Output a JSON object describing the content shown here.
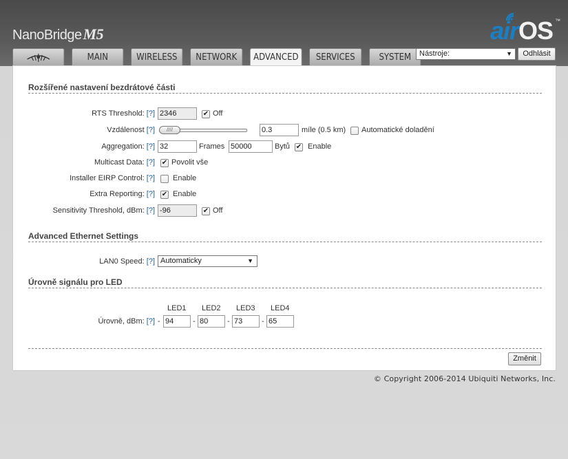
{
  "header": {
    "brand": "NanoBridge",
    "model": "M5",
    "logo_air": "air",
    "logo_os": "OS",
    "logo_tm": "™"
  },
  "tabs": [
    {
      "label": "MAIN"
    },
    {
      "label": "WIRELESS"
    },
    {
      "label": "NETWORK"
    },
    {
      "label": "ADVANCED"
    },
    {
      "label": "SERVICES"
    },
    {
      "label": "SYSTEM"
    }
  ],
  "toolbar": {
    "tools_selected": "Nástroje:",
    "logout_label": "Odhlásit"
  },
  "help": "[?]",
  "wireless": {
    "title": "Rozšířené nastavení bezdrátové části",
    "rts_label": "RTS Threshold:",
    "rts_value": "2346",
    "rts_off": "Off",
    "distance_label": "Vzdálenost",
    "distance_value": "0.3",
    "distance_unit": "míle (0.5 km)",
    "distance_auto": "Automatické doladění",
    "slider_position": 0.0,
    "aggregation_label": "Aggregation:",
    "aggregation_frames": "32",
    "aggregation_frames_unit": "Frames",
    "aggregation_bytes": "50000",
    "aggregation_bytes_unit": "Bytů",
    "aggregation_enable": "Enable",
    "multicast_label": "Multicast Data:",
    "multicast_option": "Povolit vše",
    "eirp_label": "Installer EIRP Control:",
    "eirp_enable": "Enable",
    "extra_label": "Extra Reporting:",
    "extra_enable": "Enable",
    "sensitivity_label": "Sensitivity Threshold, dBm:",
    "sensitivity_value": "-96",
    "sensitivity_off": "Off"
  },
  "ethernet": {
    "title": "Advanced Ethernet Settings",
    "lan0_label": "LAN0 Speed:",
    "lan0_value": "Automaticky"
  },
  "led": {
    "title": "Úrovně signálu pro LED",
    "levels_label": "Úrovně, dBm:",
    "dash": "-",
    "headers": [
      "LED1",
      "LED2",
      "LED3",
      "LED4"
    ],
    "values": [
      "94",
      "80",
      "73",
      "65"
    ]
  },
  "footer": {
    "apply_label": "Změnit",
    "copyright": "© Copyright 2006-2014 Ubiquiti Networks, Inc."
  }
}
